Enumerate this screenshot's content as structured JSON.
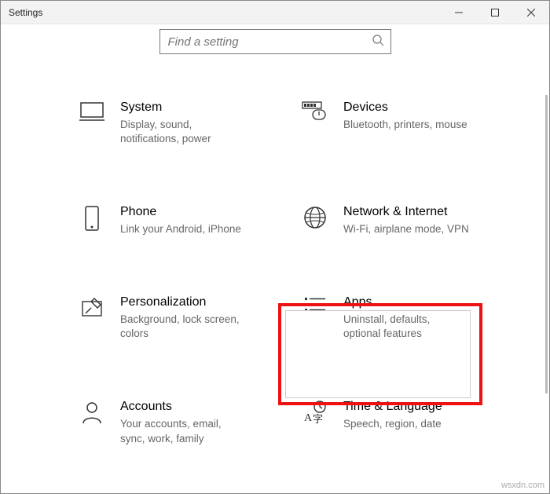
{
  "window": {
    "title": "Settings"
  },
  "search": {
    "placeholder": "Find a setting"
  },
  "tiles": {
    "system": {
      "title": "System",
      "sub": "Display, sound, notifications, power"
    },
    "devices": {
      "title": "Devices",
      "sub": "Bluetooth, printers, mouse"
    },
    "phone": {
      "title": "Phone",
      "sub": "Link your Android, iPhone"
    },
    "network": {
      "title": "Network & Internet",
      "sub": "Wi-Fi, airplane mode, VPN"
    },
    "personal": {
      "title": "Personalization",
      "sub": "Background, lock screen, colors"
    },
    "apps": {
      "title": "Apps",
      "sub": "Uninstall, defaults, optional features"
    },
    "accounts": {
      "title": "Accounts",
      "sub": "Your accounts, email, sync, work, family"
    },
    "time": {
      "title": "Time & Language",
      "sub": "Speech, region, date"
    }
  },
  "watermark": "wsxdn.com"
}
